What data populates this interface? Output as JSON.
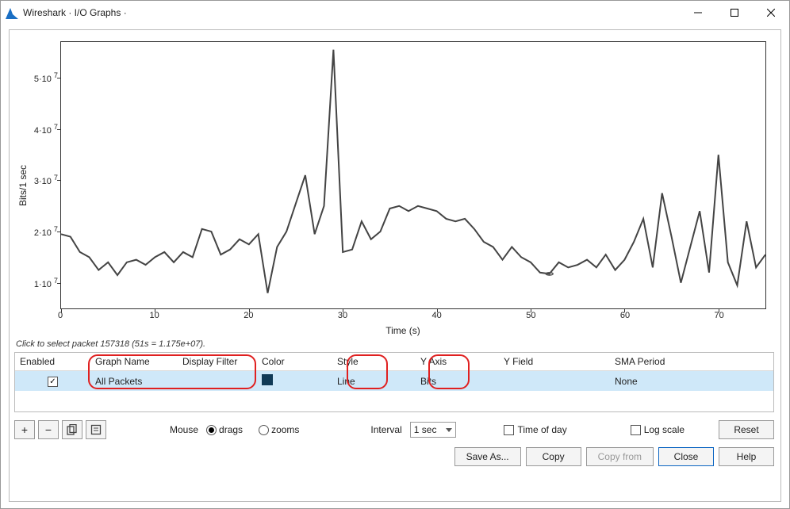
{
  "window": {
    "title": "Wireshark · I/O Graphs ·",
    "min_icon": "minimize-icon",
    "max_icon": "maximize-icon",
    "close_icon": "close-icon"
  },
  "chart": {
    "ylabel": "Bits/1 sec",
    "xlabel": "Time (s)",
    "yticks": [
      "1·10 7",
      "2·10 7",
      "3·10 7",
      "4·10 7",
      "5·10 7"
    ],
    "xticks": [
      "0",
      "10",
      "20",
      "30",
      "40",
      "50",
      "60",
      "70"
    ]
  },
  "chart_data": {
    "type": "line",
    "title": "",
    "xlabel": "Time (s)",
    "ylabel": "Bits/1 sec",
    "xlim": [
      0,
      75
    ],
    "ylim": [
      5000000,
      57000000
    ],
    "grid": false,
    "series": [
      {
        "name": "All Packets",
        "x": [
          0,
          1,
          2,
          3,
          4,
          5,
          6,
          7,
          8,
          9,
          10,
          11,
          12,
          13,
          14,
          15,
          16,
          17,
          18,
          19,
          20,
          21,
          22,
          23,
          24,
          25,
          26,
          27,
          28,
          29,
          30,
          31,
          32,
          33,
          34,
          35,
          36,
          37,
          38,
          39,
          40,
          41,
          42,
          43,
          44,
          45,
          46,
          47,
          48,
          49,
          50,
          51,
          52,
          53,
          54,
          55,
          56,
          57,
          58,
          59,
          60,
          61,
          62,
          63,
          64,
          65,
          66,
          67,
          68,
          69,
          70,
          71,
          72,
          73,
          74,
          75
        ],
        "values": [
          19500000,
          19000000,
          16000000,
          15000000,
          12500000,
          14000000,
          11500000,
          14000000,
          14500000,
          13500000,
          15000000,
          16000000,
          14000000,
          16000000,
          15000000,
          20500000,
          20000000,
          15500000,
          16500000,
          18500000,
          17500000,
          19500000,
          8000000,
          17000000,
          20000000,
          25500000,
          31000000,
          19500000,
          25000000,
          55500000,
          16000000,
          16500000,
          22000000,
          18500000,
          20000000,
          24500000,
          25000000,
          24000000,
          25000000,
          24500000,
          24000000,
          22500000,
          22000000,
          22500000,
          20500000,
          18000000,
          17000000,
          14500000,
          17000000,
          15000000,
          14000000,
          12000000,
          11750000,
          14000000,
          13000000,
          13500000,
          14500000,
          13000000,
          15500000,
          12500000,
          14500000,
          18000000,
          22500000,
          13000000,
          27500000,
          19000000,
          10000000,
          17000000,
          24000000,
          12000000,
          35000000,
          14000000,
          9500000,
          22000000,
          13000000,
          15500000
        ]
      }
    ],
    "markers": [
      {
        "x": 52,
        "y": 11750000
      }
    ]
  },
  "status": "Click to select packet 157318 (51s = 1.175e+07).",
  "table": {
    "headers": {
      "enabled": "Enabled",
      "name": "Graph Name",
      "filter": "Display Filter",
      "color": "Color",
      "style": "Style",
      "yaxis": "Y Axis",
      "yfield": "Y Field",
      "sma": "SMA Period"
    },
    "row": {
      "checked": true,
      "name": "All Packets",
      "filter": "",
      "color": "#103a56",
      "style": "Line",
      "yaxis": "Bits",
      "yfield": "",
      "sma": "None"
    }
  },
  "toolbar": {
    "add": "+",
    "remove": "−",
    "mouse_label": "Mouse",
    "radio_drags": "drags",
    "radio_zooms": "zooms",
    "interval_label": "Interval",
    "interval_value": "1 sec",
    "timeofday": "Time of day",
    "logscale": "Log scale",
    "reset": "Reset"
  },
  "buttons": {
    "saveas": "Save As...",
    "copy": "Copy",
    "copyfrom": "Copy from",
    "close": "Close",
    "help": "Help"
  }
}
